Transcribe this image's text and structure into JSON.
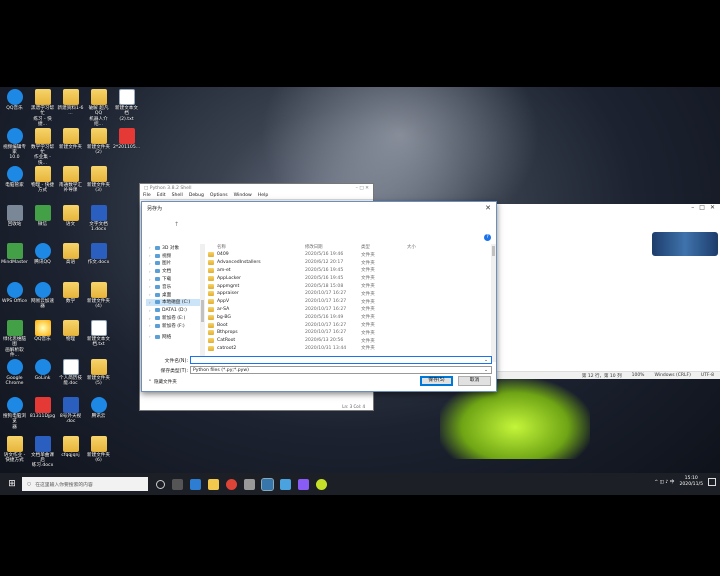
{
  "desktop": {
    "icons": [
      {
        "label": "QQ音乐",
        "kind": "blue"
      },
      {
        "label": "黑谱学习帮忙\n练习 - 快捷...",
        "kind": "folder"
      },
      {
        "label": "新建资料1-6\n...",
        "kind": "folder"
      },
      {
        "label": "破解 超凡QQ\n机器人介绍...",
        "kind": "folder"
      },
      {
        "label": "新建文本文档\n(2).txt",
        "kind": "doc"
      },
      {
        "label": "视频编辑专家\n10.0",
        "kind": "blue"
      },
      {
        "label": "数学学习帮忙\n作业集 - 快...",
        "kind": "folder"
      },
      {
        "label": "新建文件夹",
        "kind": "folder"
      },
      {
        "label": "新建文件夹\n(2)",
        "kind": "folder"
      },
      {
        "label": "2*201105...",
        "kind": "red"
      },
      {
        "label": "电脑管家",
        "kind": "blue"
      },
      {
        "label": "物理 - 快捷\n方式",
        "kind": "folder"
      },
      {
        "label": "南通数学汇\n补导课",
        "kind": "folder"
      },
      {
        "label": "新建文件夹\n(3)",
        "kind": "folder"
      },
      {
        "label": "回收站",
        "kind": "grey"
      },
      {
        "label": "微信",
        "kind": "green"
      },
      {
        "label": "语文",
        "kind": "folder"
      },
      {
        "label": "文字文档\n1.docx",
        "kind": "word"
      },
      {
        "label": "MindMaster",
        "kind": "green"
      },
      {
        "label": "腾讯QQ",
        "kind": "blue"
      },
      {
        "label": "高语",
        "kind": "folder"
      },
      {
        "label": "作文.docx",
        "kind": "word"
      },
      {
        "label": "WPS Office",
        "kind": "blue"
      },
      {
        "label": "网易云加速器",
        "kind": "blue"
      },
      {
        "label": "数学",
        "kind": "folder"
      },
      {
        "label": "新建文件夹\n(4)",
        "kind": "folder"
      },
      {
        "label": "绿化思维脑图\n画解析软件...",
        "kind": "green"
      },
      {
        "label": "QQ音乐",
        "kind": "paint"
      },
      {
        "label": "物理",
        "kind": "folder"
      },
      {
        "label": "新建文本文\n档.txt",
        "kind": "doc"
      },
      {
        "label": "Google\nChrome",
        "kind": "blue"
      },
      {
        "label": "GoLink",
        "kind": "blue"
      },
      {
        "label": "个人简历技\n能.doc",
        "kind": "doc"
      },
      {
        "label": "新建文件夹\n(5)",
        "kind": "folder"
      },
      {
        "label": "搜狗电脑浏览\n器",
        "kind": "blue"
      },
      {
        "label": "81311Djpg",
        "kind": "red"
      },
      {
        "label": "8号外天视\n.doc",
        "kind": "word"
      },
      {
        "label": "腾讯云",
        "kind": "blue"
      },
      {
        "label": "语文作业 -\n快捷方式",
        "kind": "folder"
      },
      {
        "label": "文档单曲课后\n练习.docx",
        "kind": "word"
      },
      {
        "label": "cfqqjqnj",
        "kind": "folder"
      },
      {
        "label": "新建文件夹\n(6)",
        "kind": "folder"
      }
    ]
  },
  "shell_window": {
    "title": "□ Python 3.8.2 Shell",
    "menu": [
      "File",
      "Edit",
      "Shell",
      "Debug",
      "Options",
      "Window",
      "Help"
    ],
    "status": "Ln: 3  Col: 4"
  },
  "notepad_status": {
    "position": "第 12 行，第 10 列",
    "zoom": "100%",
    "eol": "Windows (CRLF)",
    "encoding": "UTF-8"
  },
  "dialog": {
    "title": "另存为",
    "close": "✕",
    "up_arrow": "↑",
    "help": "?",
    "tree": [
      {
        "label": "3D 对象",
        "sel": false
      },
      {
        "label": "视频",
        "sel": false
      },
      {
        "label": "图片",
        "sel": false
      },
      {
        "label": "文档",
        "sel": false
      },
      {
        "label": "下载",
        "sel": false
      },
      {
        "label": "音乐",
        "sel": false
      },
      {
        "label": "桌面",
        "sel": false
      },
      {
        "label": "本地磁盘 (C:)",
        "sel": true
      },
      {
        "label": "DATA1 (D:)",
        "sel": false
      },
      {
        "label": "新加卷 (E:)",
        "sel": false
      },
      {
        "label": "新加卷 (F:)",
        "sel": false
      },
      {
        "label": "网络",
        "sel": false
      }
    ],
    "columns": {
      "name": "名称",
      "date": "修改日期",
      "type": "类型",
      "size": "大小"
    },
    "files": [
      {
        "name": "0409",
        "date": "2020/5/16 19:46",
        "type": "文件夹"
      },
      {
        "name": "AdvancedInstallers",
        "date": "2020/6/12 20:17",
        "type": "文件夹"
      },
      {
        "name": "am-et",
        "date": "2020/5/16 19:45",
        "type": "文件夹"
      },
      {
        "name": "AppLocker",
        "date": "2020/5/16 19:45",
        "type": "文件夹"
      },
      {
        "name": "appmgmt",
        "date": "2020/5/18 15:08",
        "type": "文件夹"
      },
      {
        "name": "appraiser",
        "date": "2020/10/17 16:27",
        "type": "文件夹"
      },
      {
        "name": "AppV",
        "date": "2020/10/17 16:27",
        "type": "文件夹"
      },
      {
        "name": "ar-SA",
        "date": "2020/10/17 16:27",
        "type": "文件夹"
      },
      {
        "name": "bg-BG",
        "date": "2020/5/16 19:49",
        "type": "文件夹"
      },
      {
        "name": "Boot",
        "date": "2020/10/17 16:27",
        "type": "文件夹"
      },
      {
        "name": "Bthprops",
        "date": "2020/10/17 16:27",
        "type": "文件夹"
      },
      {
        "name": "CatRoot",
        "date": "2020/6/13 20:56",
        "type": "文件夹"
      },
      {
        "name": "catroot2",
        "date": "2020/10/31 13:44",
        "type": "文件夹"
      }
    ],
    "filename_label": "文件名(N):",
    "filename_value": "",
    "filetype_label": "保存类型(T):",
    "filetype_value": "Python files (*.py;*.pyw)",
    "hide_folders": "隐藏文件夹",
    "save": "保存(S)",
    "cancel": "取消"
  },
  "taskbar": {
    "start": "⊞",
    "search_placeholder": "在这里输入你要搜索的内容",
    "time": "15:10",
    "date": "2020/11/5",
    "tray_text": "^ ◫ ♪ 中"
  }
}
